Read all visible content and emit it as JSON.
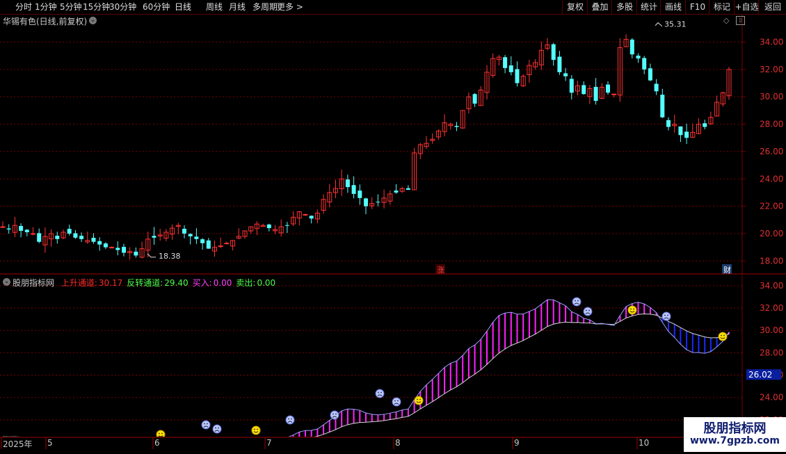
{
  "toolbar": {
    "periods": [
      "分时",
      "1分钟",
      "5分钟",
      "15分钟",
      "30分钟",
      "60分钟",
      "日线",
      "周线",
      "月线",
      "多周期",
      "更多 >"
    ],
    "active_period": "日线",
    "right_buttons": [
      "复权",
      "叠加",
      "多股",
      "统计",
      "画线",
      "F10",
      "标记",
      "+自选",
      "返回"
    ]
  },
  "main_chart": {
    "title": "华锡有色(日线,前复权)",
    "high_label": "35.31",
    "low_label": "18.38",
    "y_ticks": [
      "34.00",
      "32.00",
      "30.00",
      "28.00",
      "26.00",
      "24.00",
      "22.00",
      "20.00",
      "18.00"
    ],
    "badge_zhang": "涨",
    "badge_cai": "财"
  },
  "indicator": {
    "name": "股朋指标网",
    "items": [
      {
        "label": "上升通道:",
        "value": "30.17",
        "color": "#ff2a2a"
      },
      {
        "label": "反转通道:",
        "value": "29.40",
        "color": "#4cff4c"
      },
      {
        "label": "买入:",
        "value": "0.00",
        "color": "#ff44ff"
      },
      {
        "label": "卖出:",
        "value": "0.00",
        "color": "#4cff4c"
      }
    ],
    "y_ticks": [
      "34.00",
      "32.00",
      "30.00",
      "28.00",
      "26.00",
      "24.00",
      "22.00"
    ],
    "current_value": "26.02"
  },
  "x_axis": {
    "labels": [
      "2025年",
      "5",
      "6",
      "7",
      "8",
      "9",
      "10"
    ]
  },
  "watermark": {
    "line1": "股朋指标网",
    "line2": "www.7gpzb.com"
  },
  "colors": {
    "up": "#ff3333",
    "down": "#54ffff",
    "grid": "#7a0000",
    "channel_up": "#ff22ff",
    "channel_down": "#1a2aff"
  },
  "chart_data": {
    "type": "candlestick",
    "series": [
      {
        "name": "上升通道",
        "values": []
      },
      {
        "name": "反转通道",
        "values": []
      }
    ],
    "price_ylim": [
      17.0,
      35.5
    ],
    "indicator_ylim": [
      20.5,
      34.8
    ],
    "close_prices": [
      20.5,
      20.3,
      20.6,
      20.2,
      20.1,
      20.0,
      19.4,
      19.8,
      20.0,
      19.6,
      20.1,
      20.0,
      19.7,
      19.6,
      19.5,
      19.4,
      19.2,
      19.0,
      19.0,
      18.8,
      18.6,
      18.7,
      18.4,
      18.9,
      19.6,
      19.7,
      19.9,
      20.1,
      20.4,
      20.6,
      20.0,
      19.8,
      19.6,
      19.3,
      18.9,
      19.0,
      19.1,
      19.3,
      19.5,
      19.8,
      20.2,
      20.5,
      20.7,
      20.6,
      20.4,
      20.3,
      20.5,
      20.6,
      21.2,
      21.6,
      21.4,
      21.1,
      21.5,
      22.5,
      23.0,
      23.3,
      24.0,
      23.4,
      22.9,
      22.6,
      22.0,
      22.2,
      22.3,
      22.6,
      22.9,
      23.0,
      23.3,
      23.2,
      25.9,
      26.5,
      26.6,
      26.9,
      27.5,
      28.1,
      28.0,
      27.8,
      29.0,
      30.0,
      29.5,
      30.5,
      31.8,
      32.8,
      32.9,
      32.1,
      31.8,
      31.0,
      31.5,
      32.3,
      32.5,
      33.4,
      33.8,
      32.7,
      31.8,
      31.5,
      30.3,
      30.8,
      30.2,
      30.6,
      29.7,
      30.7,
      30.3,
      30.2,
      33.6,
      34.2,
      33.1,
      32.8,
      32.0,
      31.2,
      30.4,
      28.5,
      27.8,
      28.0,
      27.2,
      27.0,
      27.4,
      28.0,
      27.8,
      28.5,
      29.6,
      30.3,
      32.0
    ]
  }
}
